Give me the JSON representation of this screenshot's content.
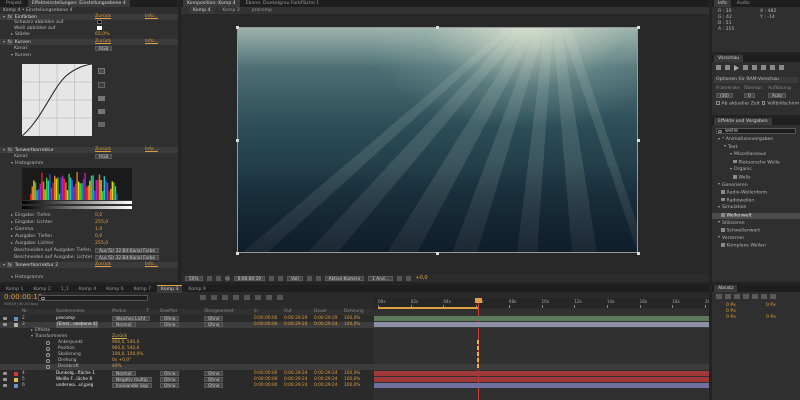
{
  "effect_controls": {
    "tabs": [
      "Projekt",
      "Effekteinstellungen: Einstellungsebene 4"
    ],
    "layer_title": "Komp 4 • Einstellungsebene 4",
    "einfaerben": {
      "name": "Einfärben",
      "reset": "Zurück",
      "info": "Info...",
      "black_label": "Schwarz abbilden auf",
      "white_label": "Weiß abbilden auf",
      "staerke_label": "Stärke",
      "staerke_value": "65,0%"
    },
    "kurven": {
      "name": "Kurven",
      "reset": "Zurück",
      "info": "Info...",
      "kanal_label": "Kanal:",
      "kanal_value": "RGB",
      "kurven_label": "Kurven"
    },
    "tonwert": {
      "name": "Tonwertkorrektur",
      "reset": "Zurück",
      "info": "Info...",
      "kanal_label": "Kanal:",
      "kanal_value": "RGB",
      "histogram_label": "Histogramm"
    },
    "params": [
      {
        "label": "Eingabe: Tiefen",
        "value": "0,0"
      },
      {
        "label": "Eingabe: Lichter",
        "value": "255,0"
      },
      {
        "label": "Gamma",
        "value": "1,0"
      },
      {
        "label": "Ausgabe: Tiefen",
        "value": "0,0"
      },
      {
        "label": "Ausgabe: Lichter",
        "value": "255,0"
      }
    ],
    "clip": [
      {
        "label": "Beschneiden auf Ausgabe: Tiefen",
        "value": "Aus für 32-Bit-Kanal Farbe"
      },
      {
        "label": "Beschneiden auf Ausgabe: Lichter",
        "value": "Aus für 32-Bit-Kanal Farbe"
      }
    ],
    "tonwert2": {
      "name": "Tonwertkorrektur 2",
      "reset": "Zurück",
      "info": "Info...",
      "histogram_label": "Histogramm"
    }
  },
  "composition": {
    "tabs": [
      "Komposition: Komp 4",
      "Ebene: Dunkelgrau Farbfläche 1"
    ],
    "breadcrumbs": [
      "Komp 4",
      "Komp 3",
      "precomp"
    ],
    "zoom": "50%",
    "timecode": "0:00:00:19",
    "quality": "Voll",
    "camera": "Aktive Kamera",
    "views": "1 Ansi...",
    "exposure": "+0,0"
  },
  "info_panel": {
    "tabs": [
      "Info",
      "Audio"
    ],
    "r_label": "R :",
    "r_value": "30",
    "g_label": "G :",
    "g_value": "42",
    "b_label": "B :",
    "b_value": "51",
    "a_label": "A :",
    "a_value": "255",
    "x_label": "X :",
    "x_value": "482",
    "y_label": "Y :",
    "y_value": "-14"
  },
  "preview_panel": {
    "tab": "Vorschau",
    "ram_options": "Optionen für RAM-Vorschau",
    "framerate_label": "Framerate",
    "skip_label": "Überspr.",
    "res_label": "Auflösung",
    "framerate_value": "(30)",
    "skip_value": "0",
    "res_value": "Auto",
    "from_current": "Ab aktueller Zeit",
    "fullscreen": "Vollbildschirm"
  },
  "effects_presets": {
    "tab": "Effekte und Vorgaben",
    "search_value": "welle",
    "items": [
      {
        "text": "* Animationsvorgaben",
        "indent": 0
      },
      {
        "text": "Text",
        "indent": 1
      },
      {
        "text": "Miscellaneous",
        "indent": 2
      },
      {
        "text": "Pleksorsche Welle",
        "indent": 3
      },
      {
        "text": "Organic",
        "indent": 2
      },
      {
        "text": "Wells",
        "indent": 3
      },
      {
        "text": "Generieren",
        "indent": 0
      },
      {
        "text": "Audio-Wellenform",
        "indent": 1
      },
      {
        "text": "Radiowellen",
        "indent": 1
      },
      {
        "text": "Simulation",
        "indent": 0
      },
      {
        "text": "Wellenwelt",
        "indent": 1,
        "selected": true
      },
      {
        "text": "Stilisieren",
        "indent": 0
      },
      {
        "text": "Schwellenwert",
        "indent": 1
      },
      {
        "text": "Verzerren",
        "indent": 0
      },
      {
        "text": "Komplexe Wellen",
        "indent": 1
      }
    ]
  },
  "timeline": {
    "tabs": [
      "Komp 1",
      "Komp 2",
      "1_1",
      "Komp 4",
      "Komp 6",
      "Komp 7",
      "Komp 3",
      "Komp 9"
    ],
    "active_tab": "Komp 3",
    "timecode": "0:00:00:19",
    "fps": "00019 (30,00 fps)",
    "columns": [
      "Nr.",
      "Quellenname",
      "Modus",
      "T",
      "BewMat",
      "Übergeordnet",
      "In",
      "Out",
      "Dauer",
      "Dehnung"
    ],
    "ruler": [
      "00s",
      "02s",
      "04s",
      "06s",
      "08s",
      "10s",
      "12s",
      "14s",
      "16s",
      "18s",
      "20s"
    ],
    "layers": [
      {
        "nr": "2",
        "name": "precomp",
        "mode": "Weiches Licht",
        "trk": "Ohne",
        "parent": "Ohne",
        "in": "0:00:00:00",
        "out": "0:00:29:29",
        "dur": "0:00:29:29",
        "stretch": "100,0%"
      },
      {
        "nr": "3",
        "name": "[Einst...seebene 4]",
        "mode": "Normal",
        "trk": "Ohne",
        "parent": "Ohne",
        "in": "0:00:00:00",
        "out": "0:00:29:24",
        "dur": "0:00:29:24",
        "stretch": "100,0%"
      }
    ],
    "effects_label": "Effekte",
    "transform_label": "Transformieren",
    "transform_reset": "Zurück",
    "props": [
      {
        "label": "Ankerpunkt",
        "value": "960,0, 540,0"
      },
      {
        "label": "Position",
        "value": "960,0, 540,0"
      },
      {
        "label": "Skalierung",
        "value": "100,0, 100,0%"
      },
      {
        "label": "Drehung",
        "value": "0x +0,0°"
      },
      {
        "label": "Deckkraft",
        "value": "40%"
      }
    ],
    "bottom_layers": [
      {
        "nr": "4",
        "name": "Dunkelg...fläche 1",
        "mode": "Normal",
        "trk": "Ohne",
        "parent": "Ohne",
        "in": "0:00:00:00",
        "out": "0:00:29:24",
        "dur": "0:00:29:24",
        "stretch": "100,0%"
      },
      {
        "nr": "5",
        "name": "Weiße F...läche 8",
        "mode": "Negativ multip",
        "trk": "Ohne",
        "parent": "Ohne",
        "in": "0:00:00:00",
        "out": "0:00:29:24",
        "dur": "0:00:29:24",
        "stretch": "100,0%"
      },
      {
        "nr": "6",
        "name": "underwa...ul.jpeg",
        "mode": "Ineinander kop",
        "trk": "Ohne",
        "parent": "Ohne",
        "in": "0:00:00:00",
        "out": "0:00:29:24",
        "dur": "0:00:29:24",
        "stretch": "100,0%"
      }
    ]
  },
  "paragraph_panel": {
    "tab": "Absatz",
    "values": [
      "0 Px",
      "0 Px",
      "0 Px",
      "0 Px",
      "0 Px"
    ]
  },
  "colors": {
    "accent": "#e0a040",
    "bg": "#2f2f2f"
  }
}
